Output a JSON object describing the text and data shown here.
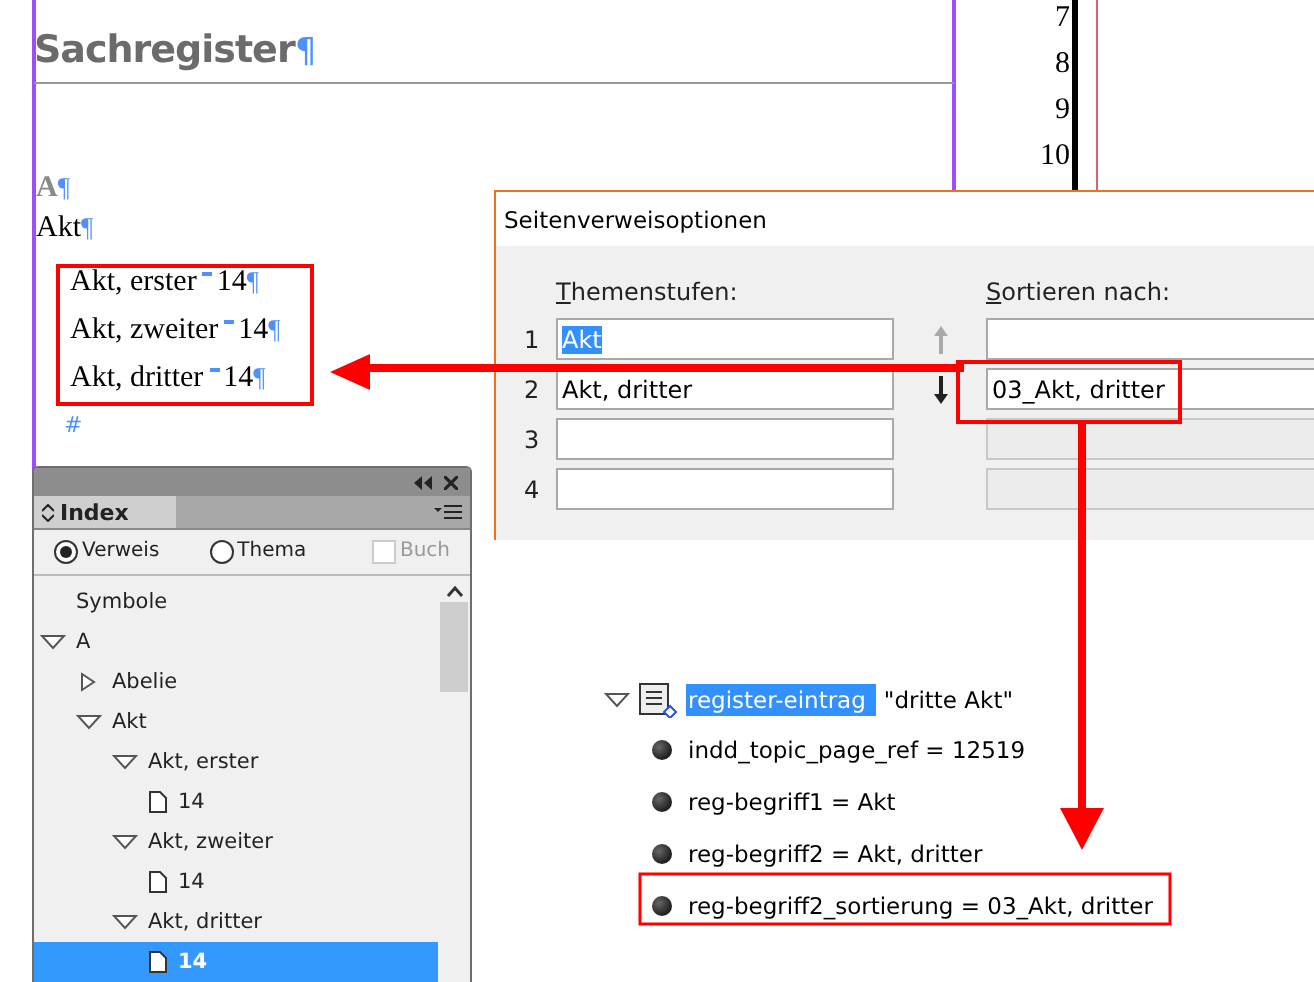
{
  "document": {
    "heading": "Sachregister",
    "heading_mark": "¶",
    "section": {
      "letter": "A",
      "mark": "¶"
    },
    "topic": {
      "text": "Akt",
      "mark": "¶"
    },
    "entries": [
      {
        "text": "Akt, erster",
        "page": "14",
        "mark": "¶"
      },
      {
        "text": "Akt, zweiter",
        "page": "14",
        "mark": "¶"
      },
      {
        "text": "Akt, dritter",
        "page": "14",
        "mark": "¶"
      }
    ],
    "end_mark": "#",
    "page_numbers": [
      "7",
      "8",
      "9",
      "10"
    ]
  },
  "dialog": {
    "title": "Seitenverweisoptionen",
    "levels_label": "Themenstufen:",
    "sort_label": "Sortieren nach:",
    "move_up": {
      "disabled": true
    },
    "move_down": {
      "disabled": false
    },
    "levels": [
      {
        "number": "1",
        "topic": "Akt",
        "topic_selected": true,
        "sort_disabled": false
      },
      {
        "number": "2",
        "topic": "Akt, dritter",
        "topic_selected": false,
        "sort": "03_Akt, dritter",
        "sort_disabled": false
      },
      {
        "number": "3",
        "sort_disabled": true
      },
      {
        "number": "4",
        "sort_disabled": true
      }
    ]
  },
  "structure": {
    "element": "register-eintrag",
    "element_selected": true,
    "value": "\"dritte Akt\"",
    "expanded": true,
    "attributes": [
      "indd_topic_page_ref = 12519",
      "reg-begriff1 = Akt",
      "reg-begriff2 = Akt, dritter",
      "reg-begriff2_sortierung = 03_Akt, dritter"
    ]
  },
  "index_panel": {
    "tab": "Index",
    "radios": [
      {
        "label": "Verweis",
        "selected": true
      },
      {
        "label": "Thema",
        "selected": false
      }
    ],
    "book": {
      "label": "Buch",
      "checked": false,
      "disabled": true
    },
    "tree": [
      {
        "kind": "label",
        "label": "Symbole",
        "selected": false
      },
      {
        "kind": "topic",
        "label": "A",
        "expanded": true,
        "selected": false,
        "children": [
          {
            "kind": "topic",
            "label": "Abelie",
            "expanded": false,
            "selected": false
          },
          {
            "kind": "topic",
            "label": "Akt",
            "expanded": true,
            "selected": false,
            "children": [
              {
                "kind": "topic",
                "label": "Akt, erster",
                "expanded": true,
                "selected": false,
                "children": [
                  {
                    "kind": "page",
                    "label": "14",
                    "selected": false
                  }
                ]
              },
              {
                "kind": "topic",
                "label": "Akt, zweiter",
                "expanded": true,
                "selected": false,
                "children": [
                  {
                    "kind": "page",
                    "label": "14",
                    "selected": false
                  }
                ]
              },
              {
                "kind": "topic",
                "label": "Akt, dritter",
                "expanded": true,
                "selected": false,
                "children": [
                  {
                    "kind": "page",
                    "label": "14",
                    "selected": true
                  }
                ]
              }
            ]
          }
        ]
      }
    ]
  }
}
